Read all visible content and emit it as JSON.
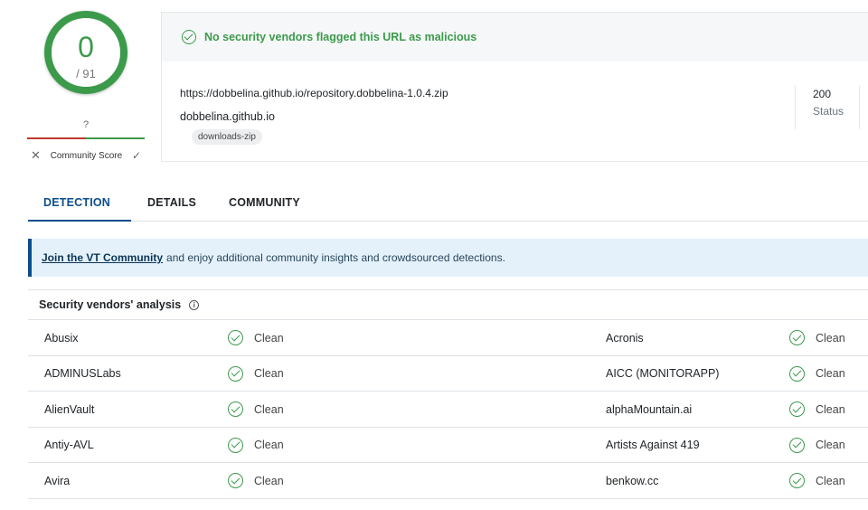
{
  "score": {
    "detections": "0",
    "total": "/ 91"
  },
  "community": {
    "question_mark": "?",
    "label": "Community Score",
    "down_icon": "close-icon",
    "up_icon": "check-icon"
  },
  "summary": {
    "banner_text": "No security vendors flagged this URL as malicious",
    "url": "https://dobbelina.github.io/repository.dobbelina-1.0.4.zip",
    "domain": "dobbelina.github.io",
    "tag": "downloads-zip",
    "status_code": "200",
    "status_label": "Status"
  },
  "tabs": [
    {
      "label": "DETECTION",
      "active": true
    },
    {
      "label": "DETAILS",
      "active": false
    },
    {
      "label": "COMMUNITY",
      "active": false
    }
  ],
  "notice": {
    "link_text": "Join the VT Community",
    "text": "and enjoy additional community insights and crowdsourced detections."
  },
  "vendors": {
    "title": "Security vendors' analysis",
    "rows": [
      {
        "left_name": "Abusix",
        "left_result": "Clean",
        "right_name": "Acronis",
        "right_result": "Clean"
      },
      {
        "left_name": "ADMINUSLabs",
        "left_result": "Clean",
        "right_name": "AICC (MONITORAPP)",
        "right_result": "Clean"
      },
      {
        "left_name": "AlienVault",
        "left_result": "Clean",
        "right_name": "alphaMountain.ai",
        "right_result": "Clean"
      },
      {
        "left_name": "Antiy-AVL",
        "left_result": "Clean",
        "right_name": "Artists Against 419",
        "right_result": "Clean"
      },
      {
        "left_name": "Avira",
        "left_result": "Clean",
        "right_name": "benkow.cc",
        "right_result": "Clean"
      }
    ]
  },
  "colors": {
    "clean": "#3c9a4b",
    "accent": "#0b4d8c",
    "notice_bg": "#e4f1fb"
  }
}
